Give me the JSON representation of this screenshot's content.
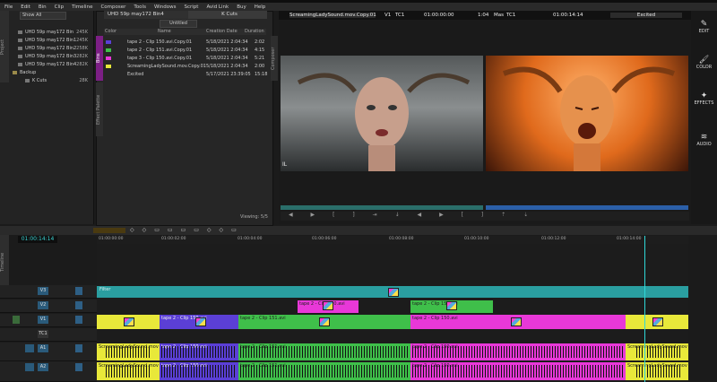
{
  "menu": [
    "File",
    "Edit",
    "Bin",
    "Clip",
    "Timeline",
    "Composer",
    "Tools",
    "Windows",
    "Script",
    "Avid Link",
    "Buy",
    "Help"
  ],
  "project": {
    "tab_label": "Project",
    "show_all": "Show All",
    "bins": [
      {
        "name": "UHD 59p may172 Bin",
        "size": "245K"
      },
      {
        "name": "UHD 59p may172 Bin1",
        "size": "245K"
      },
      {
        "name": "UHD 59p may172 Bin2",
        "size": "258K"
      },
      {
        "name": "UHD 59p may172 Bin3",
        "size": "282K"
      },
      {
        "name": "UHD 59p may172 Bin4",
        "size": "282K"
      },
      {
        "name": "Backup",
        "size": ""
      },
      {
        "name": "K Cuts",
        "size": "28K"
      }
    ]
  },
  "bin": {
    "tab1": "UHD 59p may172 Bin4",
    "tab2": "K Cuts",
    "side_tabs": [
      "Bins",
      "Effect Palette"
    ],
    "dropdown": "Untitled",
    "columns": [
      "Color",
      "Name",
      "Creation Date",
      "Duration"
    ],
    "items": [
      {
        "color": "#5b3fd6",
        "name": "tape 2 - Clip 150.avi.Copy.01",
        "date": "5/18/2021 2:04:34",
        "duration": "2:02"
      },
      {
        "color": "#3fbf4a",
        "name": "tape 2 - Clip 151.avi.Copy.01",
        "date": "5/18/2021 2:04:34",
        "duration": "4:15"
      },
      {
        "color": "#e838d8",
        "name": "tape 3 - Clip 150.avi.Copy.01",
        "date": "5/18/2021 2:04:34",
        "duration": "5:21"
      },
      {
        "color": "#e8e83a",
        "name": "ScreamingLadySound.mov.Copy.01",
        "date": "5/18/2021 2:04:34",
        "duration": "2:00"
      },
      {
        "color": "",
        "name": "Excited",
        "date": "5/17/2021 23:39:05",
        "duration": "15:18"
      }
    ],
    "viewing": "Viewing: 5/5"
  },
  "viewer": {
    "clip_name": "ScreamingLadySound.mov.Copy.01",
    "track": "V1",
    "tc_label": "TC1",
    "timecode": "01:00:00:00",
    "duration": "1:04",
    "mas_label": "Mas",
    "mas_tc": "TC1",
    "seq_tc": "01:00:14:14",
    "sequence": "Excited",
    "composer_tab": "Composer",
    "left_caption": "IL"
  },
  "sidebar": [
    {
      "icon": "pencil",
      "label": "EDIT"
    },
    {
      "icon": "brush",
      "label": "COLOR"
    },
    {
      "icon": "sparkle",
      "label": "EFFECTS"
    },
    {
      "icon": "wave",
      "label": "AUDIO"
    }
  ],
  "timeline": {
    "tab_label": "Timeline",
    "timecode": "01:00:14:14",
    "ruler": [
      "01:00:00:00",
      "01:00:02:00",
      "01:00:04:00",
      "01:00:06:00",
      "01:00:08:00",
      "01:00:10:00",
      "01:00:12:00",
      "01:00:14:00"
    ],
    "tracks": [
      "V3",
      "V2",
      "V1",
      "TC1",
      "A1",
      "A2"
    ],
    "filter_label": "Filter",
    "v2_clips": [
      "tape 2 - Clip 150.avi",
      "tape 2 - Clip 150.avi"
    ],
    "v1_clips": [
      "tape 2 - Clip 150.avi",
      "tape 2 - Clip 151.avi",
      "tape 2 - Clip 150.avi"
    ],
    "a1_clips": [
      "ScreamingLadySound.mov",
      "tape 2 - Clip 150.avi",
      "tape 2 - Clip 151.avi",
      "tape 2 - Clip 150.avi",
      "ScreamingLadySound.mov"
    ],
    "a2_clips": [
      "ScreamingLadySound.mov",
      "tape 2 - Clip 150.avi",
      "tape 2 - Clip 151.avi",
      "tape 2 - Clip 150.avi",
      "ScreamingLadySound.mov"
    ]
  },
  "colors": {
    "purple": "#5b3fd6",
    "green": "#3fbf4a",
    "magenta": "#e838d8",
    "yellow": "#e8e83a",
    "teal": "#2a9ea0"
  }
}
